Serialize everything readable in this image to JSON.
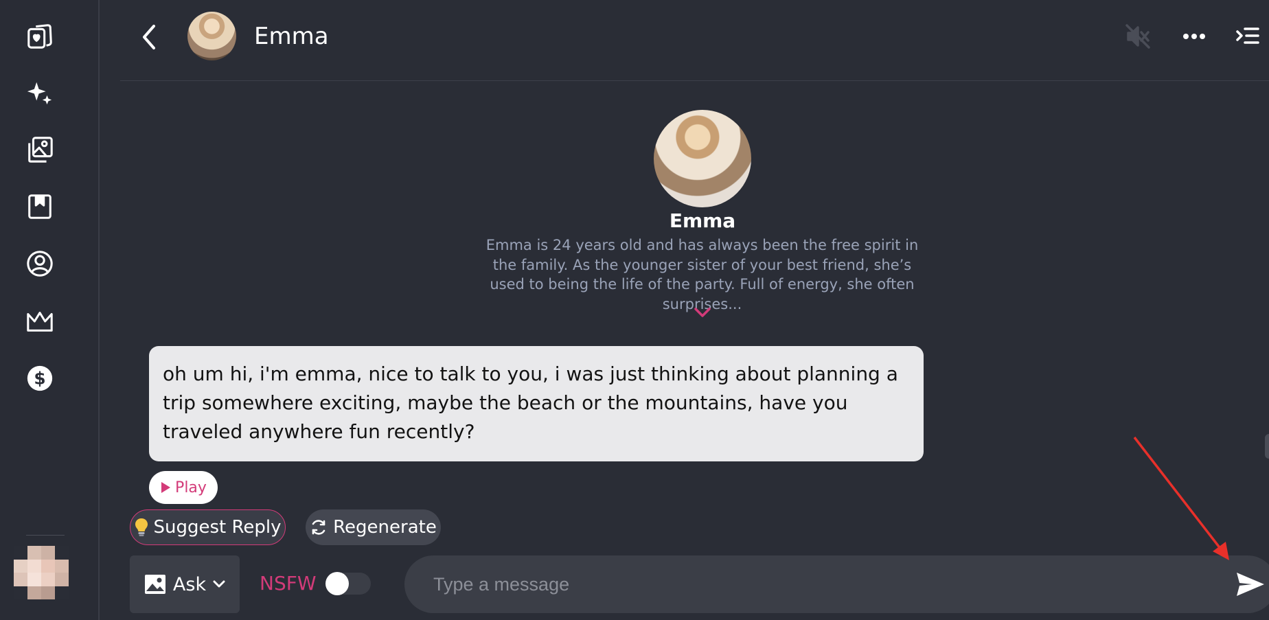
{
  "sidebar": {
    "items": [
      {
        "icon": "cards-heart-icon"
      },
      {
        "icon": "sparkles-icon"
      },
      {
        "icon": "gallery-icon"
      },
      {
        "icon": "bookmark-icon"
      },
      {
        "icon": "profile-icon"
      },
      {
        "icon": "crown-icon"
      },
      {
        "icon": "dollar-icon"
      }
    ],
    "user_avatar": "pixelated-avatar"
  },
  "header": {
    "name": "Emma",
    "icons": [
      "back-icon",
      "muted-speaker-icon",
      "more-icon",
      "menu-icon"
    ]
  },
  "profile": {
    "name": "Emma",
    "description": "Emma is 24 years old and has always been the free spirit in the family. As the younger sister of your best friend, she’s used to being the life of the party. Full of energy, she often surprises..."
  },
  "message": {
    "text": "oh um hi, i'm emma, nice to talk to you, i was just thinking about planning a trip somewhere exciting, maybe the beach or the mountains, have you traveled anywhere fun recently?"
  },
  "actions": {
    "play_label": "Play",
    "suggest_label": "Suggest Reply",
    "regenerate_label": "Regenerate"
  },
  "composer": {
    "ask_label": "Ask",
    "nsfw_label": "NSFW",
    "nsfw_enabled": false,
    "placeholder": "Type a message"
  },
  "colors": {
    "background": "#2a2d36",
    "accent": "#d33b79",
    "bubble": "#e9e9eb",
    "annotation_arrow": "#e8302a"
  }
}
